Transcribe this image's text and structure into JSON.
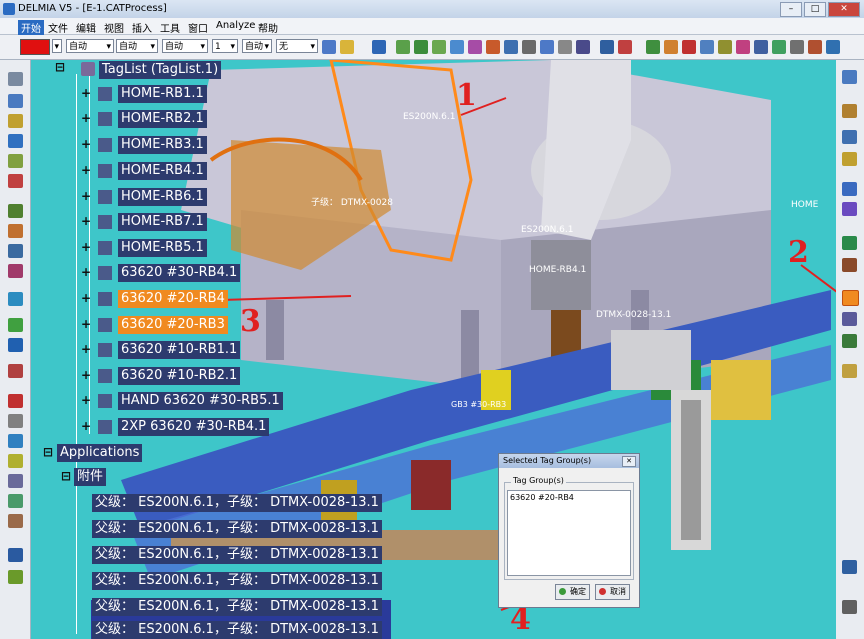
{
  "window": {
    "title": "DELMIA V5 - [E-1.CATProcess]"
  },
  "window_buttons": {
    "minimize": "–",
    "maximize": "□",
    "close": "✕"
  },
  "menu": [
    "开始",
    "文件",
    "编辑",
    "视图",
    "插入",
    "工具",
    "窗口",
    "Analyze",
    "帮助"
  ],
  "toolbar": {
    "color_value": "#e01010",
    "selects": [
      "自动",
      "自动",
      "自动",
      "1",
      "自动",
      "无"
    ]
  },
  "tree": {
    "root": "TagList (TagList.1)",
    "items": [
      {
        "label": "HOME-RB1.1",
        "style": "dark"
      },
      {
        "label": "HOME-RB2.1",
        "style": "dark"
      },
      {
        "label": "HOME-RB3.1",
        "style": "dark"
      },
      {
        "label": "HOME-RB4.1",
        "style": "dark"
      },
      {
        "label": "HOME-RB6.1",
        "style": "dark"
      },
      {
        "label": "HOME-RB7.1",
        "style": "dark"
      },
      {
        "label": "HOME-RB5.1",
        "style": "dark"
      },
      {
        "label": "63620 #30-RB4.1",
        "style": "dark"
      },
      {
        "label": "63620 #20-RB4",
        "style": "orange"
      },
      {
        "label": "63620 #20-RB3",
        "style": "orange"
      },
      {
        "label": "63620 #10-RB1.1",
        "style": "dark"
      },
      {
        "label": "63620 #10-RB2.1",
        "style": "dark"
      },
      {
        "label": "HAND 63620 #30-RB5.1",
        "style": "dark"
      },
      {
        "label": "2XP 63620 #30-RB4.1",
        "style": "dark"
      }
    ],
    "applications": "Applications",
    "sub_node": "附件",
    "children": [
      "父级： ES200N.6.1，子级： DTMX-0028-13.1",
      "父级： ES200N.6.1，子级： DTMX-0028-13.1",
      "父级： ES200N.6.1，子级： DTMX-0028-13.1",
      "父级： ES200N.6.1，子级： DTMX-0028-13.1",
      "父级： ES200N.6.1，子级： DTMX-0028-13.1",
      "父级： ES200N.6.1，子级： DTMX-0028-13.1"
    ]
  },
  "scene_labels": {
    "robot_a": "ES200N.6.1",
    "robot_b": "ES200N.6.1",
    "child_a": "子级： DTMX-0028",
    "child_b": "DTMX-0028-13.1",
    "home": "HOME-RB4.1",
    "home2": "HOME",
    "gb3": "GB3 #30-RB3"
  },
  "annotations": [
    "1",
    "2",
    "3",
    "4"
  ],
  "dialog": {
    "title": "Selected Tag Group(s)",
    "group_label": "Tag Group(s)",
    "selected_item": "63620 #20-RB4",
    "ok": "确定",
    "cancel": "取消"
  },
  "colors": {
    "accent_dark": "#2d3b6e",
    "highlight": "#f08a20",
    "annotation": "#e02020",
    "background": "#3ec6c9"
  }
}
